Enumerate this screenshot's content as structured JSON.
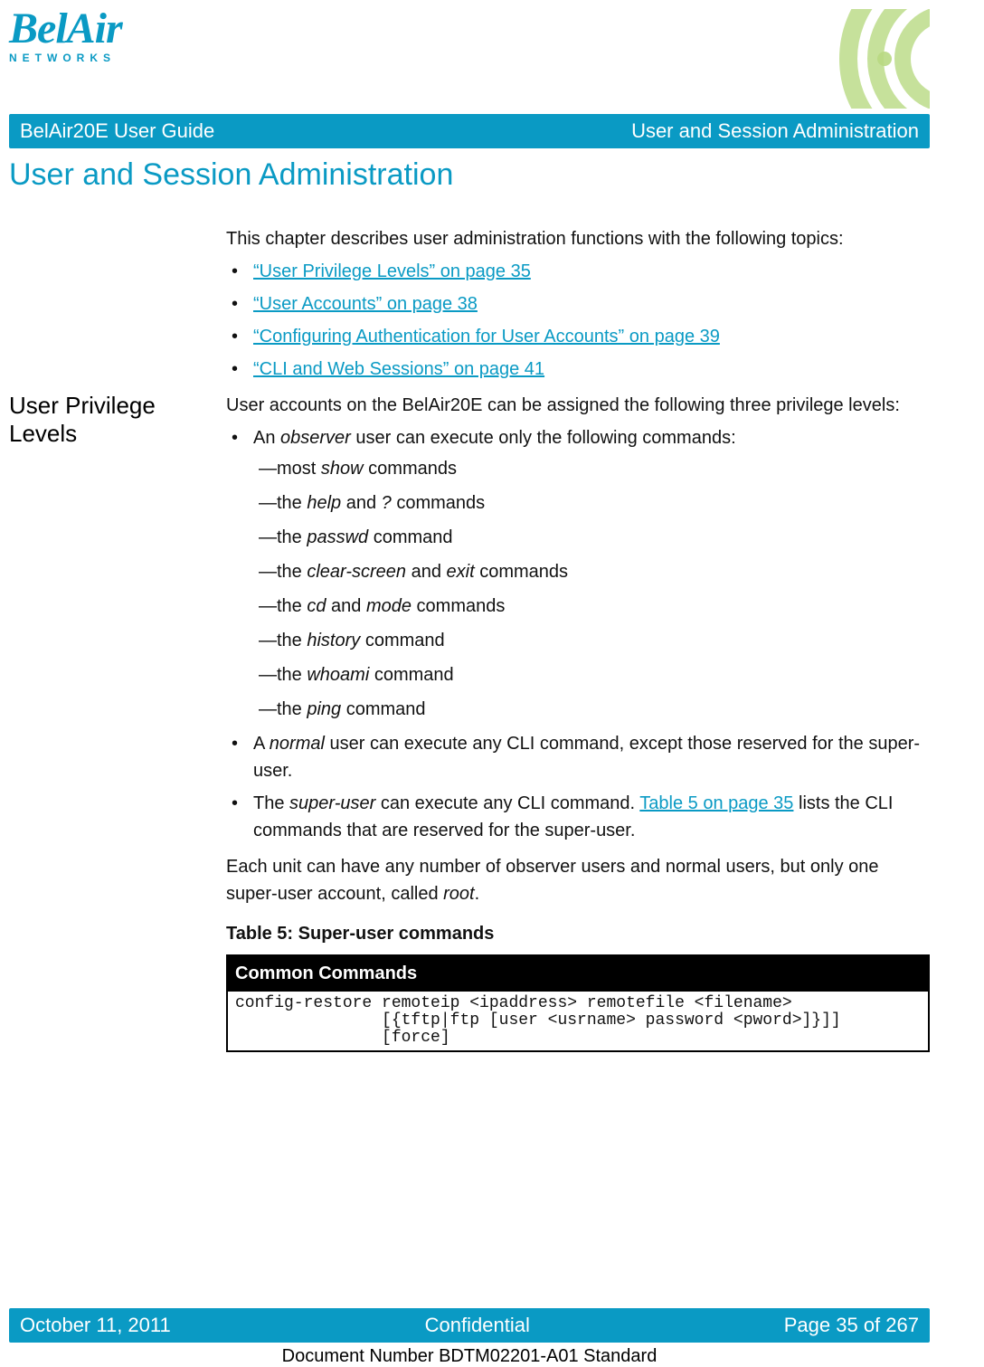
{
  "header": {
    "logo_main_a": "Bel",
    "logo_main_b": "Air",
    "logo_sub": "NETWORKS",
    "breadcrumb_left": "BelAir20E User Guide",
    "breadcrumb_right": "User and Session Administration"
  },
  "chapter": {
    "title": "User and Session Administration",
    "intro": "This chapter describes user administration functions with the following topics:",
    "toc": [
      "“User Privilege Levels” on page 35",
      "“User Accounts” on page 38",
      "“Configuring Authentication for User Accounts” on page 39",
      "“CLI and Web Sessions” on page 41"
    ]
  },
  "section": {
    "heading": "User Privilege Levels",
    "lead": "User accounts on the BelAir20E can be assigned the following three privilege levels:",
    "observer_intro_a": "An ",
    "observer_intro_b": "observer",
    "observer_intro_c": " user can execute only the following commands:",
    "observer_cmds": {
      "c1_a": "most ",
      "c1_b": "show",
      "c1_c": " commands",
      "c2_a": "the ",
      "c2_b": "help",
      "c2_c": " and ",
      "c2_d": "?",
      "c2_e": " commands",
      "c3_a": "the ",
      "c3_b": "passwd",
      "c3_c": " command",
      "c4_a": "the ",
      "c4_b": "clear-screen",
      "c4_c": " and ",
      "c4_d": "exit",
      "c4_e": " commands",
      "c5_a": "the ",
      "c5_b": "cd",
      "c5_c": " and ",
      "c5_d": "mode",
      "c5_e": " commands",
      "c6_a": "the ",
      "c6_b": "history",
      "c6_c": " command",
      "c7_a": "the ",
      "c7_b": "whoami",
      "c7_c": " command",
      "c8_a": "the ",
      "c8_b": "ping",
      "c8_c": " command"
    },
    "normal_a": "A ",
    "normal_b": "normal",
    "normal_c": " user can execute any CLI command, except those reserved for the super-user.",
    "super_a": "The ",
    "super_b": "super-user",
    "super_c": " can execute any CLI command. ",
    "super_link": "Table 5 on page 35",
    "super_d": " lists the CLI commands that are reserved for the super-user.",
    "after_a": "Each unit can have any number of observer users and normal users, but only one super-user account, called ",
    "after_b": "root",
    "after_c": ".",
    "table_title": "Table 5: Super-user commands",
    "table_header": "Common Commands",
    "table_cell": "config-restore remoteip <ipaddress> remotefile <filename>\n               [{tftp|ftp [user <usrname> password <pword>]}]]\n               [force]"
  },
  "footer": {
    "date": "October 11, 2011",
    "conf": "Confidential",
    "page": "Page 35 of 267",
    "docnum": "Document Number BDTM02201-A01 Standard"
  }
}
